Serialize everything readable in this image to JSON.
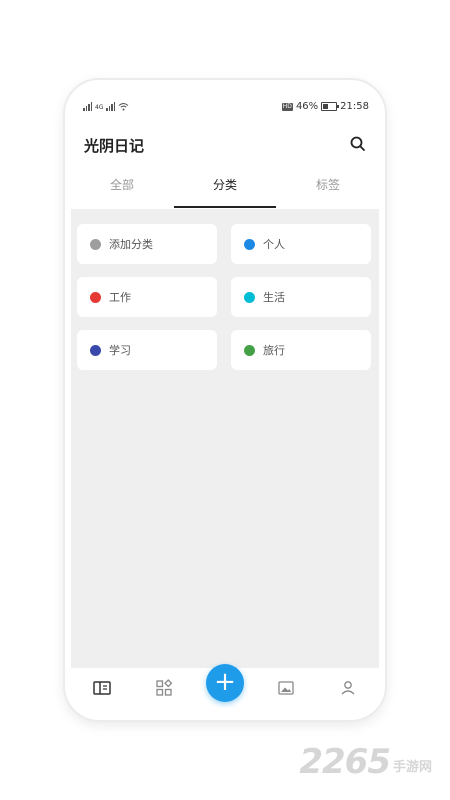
{
  "status_bar": {
    "battery": "46%",
    "time": "21:58",
    "hd": "HD",
    "network": "4G"
  },
  "app": {
    "title": "光阴日记"
  },
  "tabs": [
    {
      "label": "全部"
    },
    {
      "label": "分类",
      "active": true
    },
    {
      "label": "标签"
    }
  ],
  "categories": [
    {
      "label": "添加分类",
      "color": "#9e9e9e"
    },
    {
      "label": "个人",
      "color": "#1e88e5"
    },
    {
      "label": "工作",
      "color": "#e53935"
    },
    {
      "label": "生活",
      "color": "#00bcd4"
    },
    {
      "label": "学习",
      "color": "#3949ab"
    },
    {
      "label": "旅行",
      "color": "#43a047"
    }
  ],
  "bottom_nav": [
    {
      "icon": "journal-icon"
    },
    {
      "icon": "category-icon"
    },
    {
      "icon": "add-icon",
      "label": "+"
    },
    {
      "icon": "image-icon"
    },
    {
      "icon": "profile-icon"
    }
  ],
  "watermark": {
    "number": "2265",
    "text": "手游网"
  },
  "colors": {
    "accent": "#1e9be9",
    "background": "#efefef"
  }
}
